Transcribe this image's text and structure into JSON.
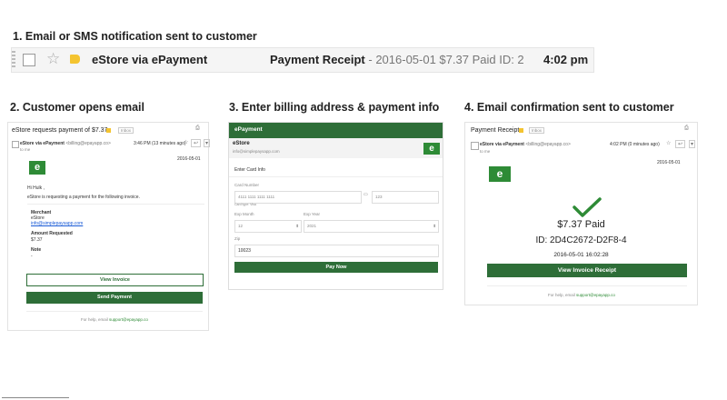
{
  "steps": {
    "s1": "1. Email or SMS notification sent to customer",
    "s2": "2. Customer opens email",
    "s3": "3. Enter billing address & payment info",
    "s4": "4. Email confirmation sent to customer"
  },
  "inbox": {
    "sender": "eStore via ePayment",
    "subject": "Payment Receipt",
    "snippet": " - 2016-05-01 $7.37 Paid ID: 2",
    "time": "4:02 pm"
  },
  "email2": {
    "subject": "eStore requests payment of $7.37",
    "inbox_label": "Inbox",
    "from_name": "eStore via ePayment",
    "from_email": "<billing@epayapp.co>",
    "to": "to me",
    "time": "3:46 PM (13 minutes ago)",
    "date": "2016-05-01",
    "logo": "e",
    "greeting": "Hi Hulk ,",
    "message": "eStore is requesting a payment for the following invoice.",
    "merchant_label": "Merchant",
    "merchant_name": "eStore",
    "merchant_email": "info@simplepaysapp.com",
    "amount_label": "Amount Requested",
    "amount": "$7.37",
    "note_label": "Note",
    "note": "-",
    "view_invoice": "View Invoice",
    "send_payment": "Send Payment",
    "footer_prefix": "For help, email ",
    "footer_email": "support@epayapp.co"
  },
  "form3": {
    "header": "ePayment",
    "store": "eStore",
    "store_email": "info@simplepaysapp.com",
    "logo": "e",
    "section": "Enter Card Info",
    "card_label": "Card Number",
    "card_value": "4111 1111 1111 1111",
    "cvc_value": "123",
    "card_type": "Card type: Visa",
    "exp_month_label": "Exp Month",
    "exp_month": "12",
    "exp_year_label": "Exp Year",
    "exp_year": "2021",
    "zip_label": "Zip",
    "zip": "10023",
    "pay_now": "Pay Now"
  },
  "email4": {
    "subject": "Payment Receipt",
    "inbox_label": "Inbox",
    "from_name": "eStore via ePayment",
    "from_email": "<billing@epayapp.co>",
    "to": "to me",
    "time": "4:02 PM (0 minutes ago)",
    "date": "2016-05-01",
    "logo": "e",
    "paid": "$7.37 Paid",
    "id": "ID: 2D4C2672-D2F8-4",
    "datetime": "2016-05-01 16:02:28",
    "view_receipt": "View Invoice Receipt",
    "footer_prefix": "For help, email ",
    "footer_email": "support@epayapp.co"
  },
  "colors": {
    "green": "#2e6e38",
    "logo_green": "#2e8b36",
    "label_yellow": "#f4c430"
  },
  "icons": [
    "checkbox-icon",
    "star-icon",
    "label-tag-icon",
    "print-icon",
    "reply-icon",
    "more-icon",
    "checkmark-icon",
    "dropdown-icon",
    "card-icon"
  ]
}
